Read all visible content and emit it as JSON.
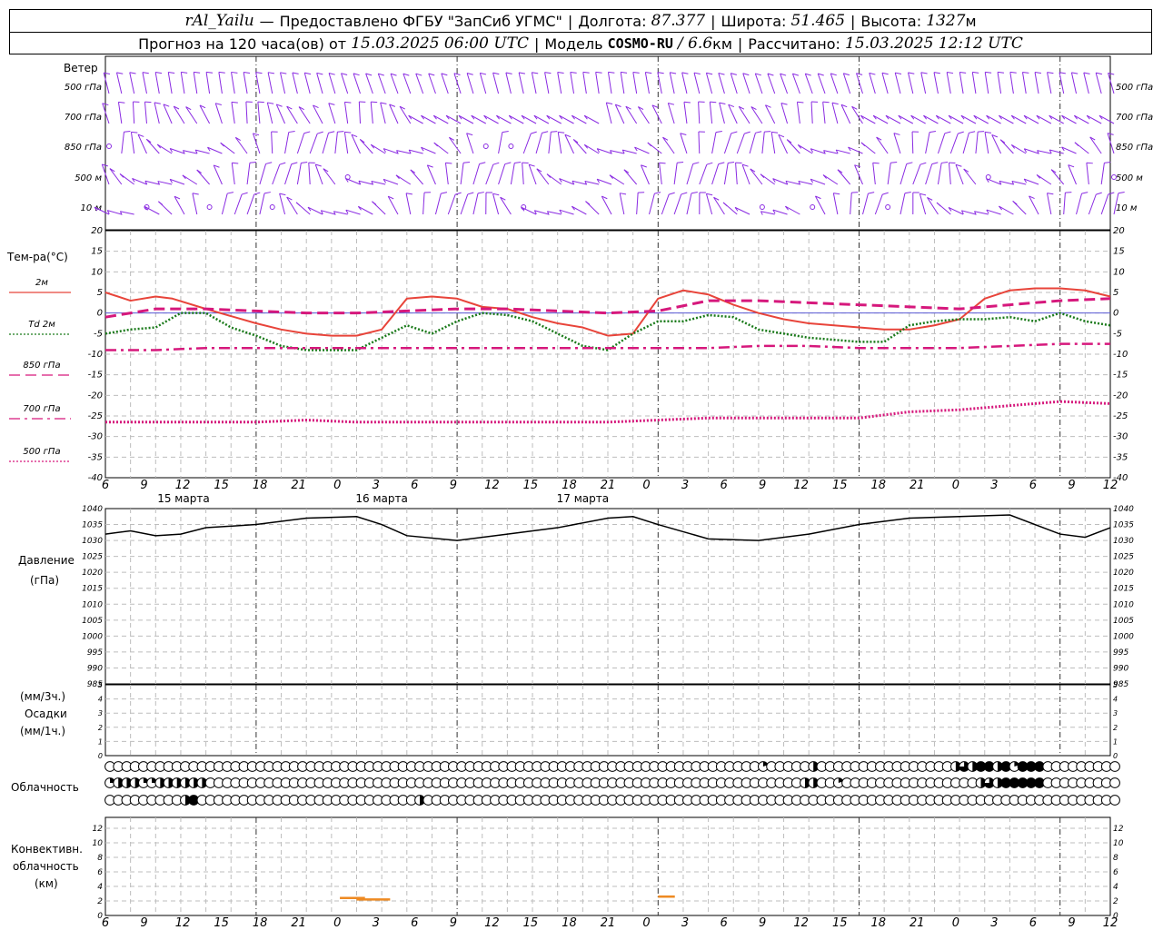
{
  "header": {
    "station": "rAl_Yailu",
    "provider": "Предоставлено ФГБУ \"ЗапСиб УГМС\"",
    "lon_label": "Долгота:",
    "lon": "87.377",
    "lat_label": "Широта:",
    "lat": "51.465",
    "alt_label": "Высота:",
    "alt": "1327",
    "alt_unit": "м",
    "forecast_prefix": "Прогноз на 120 часа(ов) от",
    "forecast_start": "15.03.2025 06:00 UTC",
    "model_label": "Модель",
    "model": "COSMO-RU",
    "resolution": "/ 6.6",
    "res_unit": "км",
    "computed_label": "Рассчитано:",
    "computed": "15.03.2025 12:12 UTC"
  },
  "panels": {
    "wind": {
      "title": "Ветер",
      "levels": [
        "500 гПа",
        "700 гПа",
        "850 гПа",
        "500 м",
        "10 м"
      ]
    },
    "temp": {
      "title": "Тем-ра(°C)"
    },
    "pressure": {
      "title": "Давление",
      "unit": "(гПа)"
    },
    "precip": {
      "unit3": "(мм/3ч.)",
      "title": "Осадки",
      "unit1": "(мм/1ч.)"
    },
    "clouds": {
      "title": "Облачность"
    },
    "convective": {
      "title1": "Конвективн.",
      "title2": "облачность",
      "unit": "(км)"
    }
  },
  "legend": [
    {
      "label": "2м",
      "color": "#e8443a",
      "dash": "solid"
    },
    {
      "label": "Td 2м",
      "color": "#1a7a1a",
      "dash": "dotted"
    },
    {
      "label": "850 гПа",
      "color": "#d6187c",
      "dash": "dashed"
    },
    {
      "label": "700 гПа",
      "color": "#d6187c",
      "dash": "dashdot"
    },
    {
      "label": "500 гПа",
      "color": "#d6187c",
      "dash": "dotted"
    }
  ],
  "time_axis": {
    "hour_labels": [
      "6",
      "9",
      "12",
      "15",
      "18",
      "21",
      "0",
      "3",
      "6",
      "9",
      "12",
      "15",
      "18",
      "21",
      "0",
      "3",
      "6",
      "9",
      "12",
      "15",
      "18",
      "21",
      "0",
      "3",
      "6",
      "9",
      "12"
    ],
    "date_labels": [
      "15 марта",
      "16 марта",
      "17 марта"
    ]
  },
  "chart_data": [
    {
      "type": "line",
      "title": "Тем-ра(°C)",
      "x_unit": "hours since 15.03.2025 06:00 UTC",
      "ylim": [
        -40,
        20
      ],
      "yticks": [
        20,
        15,
        10,
        5,
        0,
        -5,
        -10,
        -15,
        -20,
        -25,
        -30,
        -35,
        -40
      ],
      "series": [
        {
          "name": "2м",
          "color": "#e8443a",
          "x": [
            0,
            3,
            6,
            8,
            12,
            18,
            21,
            24,
            27,
            30,
            33,
            36,
            39,
            42,
            45,
            48,
            51,
            54,
            57,
            60,
            63,
            66,
            69,
            72,
            75,
            78,
            81,
            84,
            87,
            90,
            93,
            96,
            99,
            102,
            105,
            108,
            111,
            114,
            117,
            120
          ],
          "y": [
            5,
            3,
            4,
            3.5,
            1,
            -2.5,
            -4,
            -5,
            -5.5,
            -5.5,
            -4,
            3.5,
            4,
            3.5,
            1.5,
            1,
            -1,
            -2.5,
            -3.5,
            -5.5,
            -5,
            3.5,
            5.5,
            4.5,
            2,
            0,
            -1.5,
            -2.5,
            -3,
            -3.5,
            -4,
            -4,
            -3,
            -1.5,
            3.5,
            5.5,
            6,
            6,
            5.5,
            4
          ]
        },
        {
          "name": "Td 2м",
          "color": "#1a7a1a",
          "x": [
            0,
            3,
            6,
            9,
            12,
            15,
            18,
            21,
            24,
            27,
            30,
            33,
            36,
            39,
            42,
            45,
            48,
            51,
            54,
            57,
            60,
            63,
            66,
            69,
            72,
            75,
            78,
            81,
            84,
            87,
            90,
            93,
            96,
            99,
            102,
            105,
            108,
            111,
            114,
            117,
            120
          ],
          "y": [
            -5,
            -4,
            -3.5,
            0,
            0,
            -3.5,
            -5.5,
            -8,
            -9,
            -9,
            -9,
            -6,
            -3,
            -5,
            -2,
            0,
            -0.5,
            -2,
            -5,
            -8,
            -9,
            -5,
            -2,
            -2,
            -0.5,
            -1,
            -4,
            -5,
            -6,
            -6.5,
            -7,
            -7,
            -3,
            -2,
            -1.5,
            -1.5,
            -1,
            -2,
            0,
            -2,
            -3
          ]
        },
        {
          "name": "850 гПа",
          "color": "#d6187c",
          "x": [
            0,
            6,
            12,
            18,
            24,
            30,
            36,
            42,
            48,
            54,
            60,
            66,
            72,
            78,
            84,
            90,
            96,
            102,
            108,
            114,
            120
          ],
          "y": [
            -1,
            1,
            1,
            0.5,
            0,
            0,
            0.5,
            1,
            1,
            0.5,
            0,
            0.5,
            3,
            3,
            2.5,
            2,
            1.5,
            1,
            2,
            3,
            3.5
          ]
        },
        {
          "name": "700 гПа",
          "color": "#d6187c",
          "x": [
            0,
            6,
            12,
            18,
            24,
            30,
            36,
            42,
            48,
            54,
            60,
            66,
            72,
            78,
            84,
            90,
            96,
            102,
            108,
            114,
            120
          ],
          "y": [
            -9,
            -9,
            -8.5,
            -8.5,
            -8.5,
            -8.5,
            -8.5,
            -8.5,
            -8.5,
            -8.5,
            -8.5,
            -8.5,
            -8.5,
            -8,
            -8,
            -8.5,
            -8.5,
            -8.5,
            -8,
            -7.5,
            -7.5
          ]
        },
        {
          "name": "500 гПа",
          "color": "#d6187c",
          "x": [
            0,
            6,
            12,
            18,
            24,
            30,
            36,
            42,
            48,
            54,
            60,
            66,
            72,
            78,
            84,
            90,
            96,
            102,
            108,
            114,
            120
          ],
          "y": [
            -26.5,
            -26.5,
            -26.5,
            -26.5,
            -26,
            -26.5,
            -26.5,
            -26.5,
            -26.5,
            -26.5,
            -26.5,
            -26,
            -25.5,
            -25.5,
            -25.5,
            -25.5,
            -24,
            -23.5,
            -22.5,
            -21.5,
            -22
          ]
        }
      ]
    },
    {
      "type": "line",
      "title": "Давление",
      "ylim": [
        985,
        1040
      ],
      "yticks": [
        1040,
        1035,
        1030,
        1025,
        1020,
        1015,
        1010,
        1005,
        1000,
        995,
        990,
        985
      ],
      "series": [
        {
          "name": "Давление",
          "color": "#000000",
          "x": [
            0,
            3,
            6,
            9,
            12,
            18,
            24,
            30,
            33,
            36,
            42,
            48,
            54,
            60,
            63,
            66,
            72,
            78,
            84,
            90,
            96,
            102,
            108,
            114,
            117,
            120
          ],
          "y": [
            1032,
            1033,
            1031.5,
            1032,
            1034,
            1035,
            1037,
            1037.5,
            1035,
            1031.5,
            1030,
            1032,
            1034,
            1037,
            1037.5,
            1035,
            1030.5,
            1030,
            1032,
            1035,
            1037,
            1037.5,
            1038,
            1032,
            1031,
            1034
          ]
        }
      ]
    },
    {
      "type": "bar",
      "title": "Осадки",
      "ylim": [
        0,
        5
      ],
      "yticks": [
        5,
        4,
        3,
        2,
        1,
        0
      ],
      "series": [
        {
          "name": "Осадки",
          "x": [],
          "y": []
        }
      ]
    },
    {
      "type": "table",
      "title": "Облачность",
      "x_unit": "hour index from 15.03.2025 06:00 UTC",
      "rows": [
        {
          "level": "upper",
          "cover": {
            "78": 0.2,
            "84": 0.5,
            "101": 0.5,
            "102": 0.75,
            "103": 0.5,
            "104": 1,
            "105": 1,
            "106": 0.5,
            "107": 1,
            "108": 0.2,
            "109": 1,
            "110": 1,
            "111": 1
          }
        },
        {
          "level": "middle",
          "cover": {
            "0": 0.25,
            "1": 0.5,
            "2": 0.5,
            "3": 0.5,
            "4": 0.25,
            "5": 0.25,
            "6": 0.5,
            "7": 0.5,
            "8": 0.5,
            "9": 0.5,
            "10": 0.5,
            "11": 0.5,
            "83": 0.5,
            "84": 0.5,
            "87": 0.2,
            "104": 0.5,
            "105": 0.75,
            "106": 0.5,
            "107": 1,
            "108": 1,
            "109": 1,
            "110": 1,
            "111": 1
          }
        },
        {
          "level": "lower",
          "cover": {
            "9": 0.5,
            "10": 1,
            "37": 0.5
          }
        }
      ]
    },
    {
      "type": "bar",
      "title": "Конвективн. облачность",
      "ylim": [
        0,
        13
      ],
      "yticks": [
        12,
        10,
        8,
        6,
        4,
        2,
        0
      ],
      "series": [
        {
          "name": "Конвективн. облачность",
          "color": "#ee8a22",
          "segments": [
            [
              28,
              31,
              2.4
            ],
            [
              30,
              34,
              2.2
            ],
            [
              66,
              68,
              2.6
            ]
          ]
        }
      ]
    }
  ]
}
